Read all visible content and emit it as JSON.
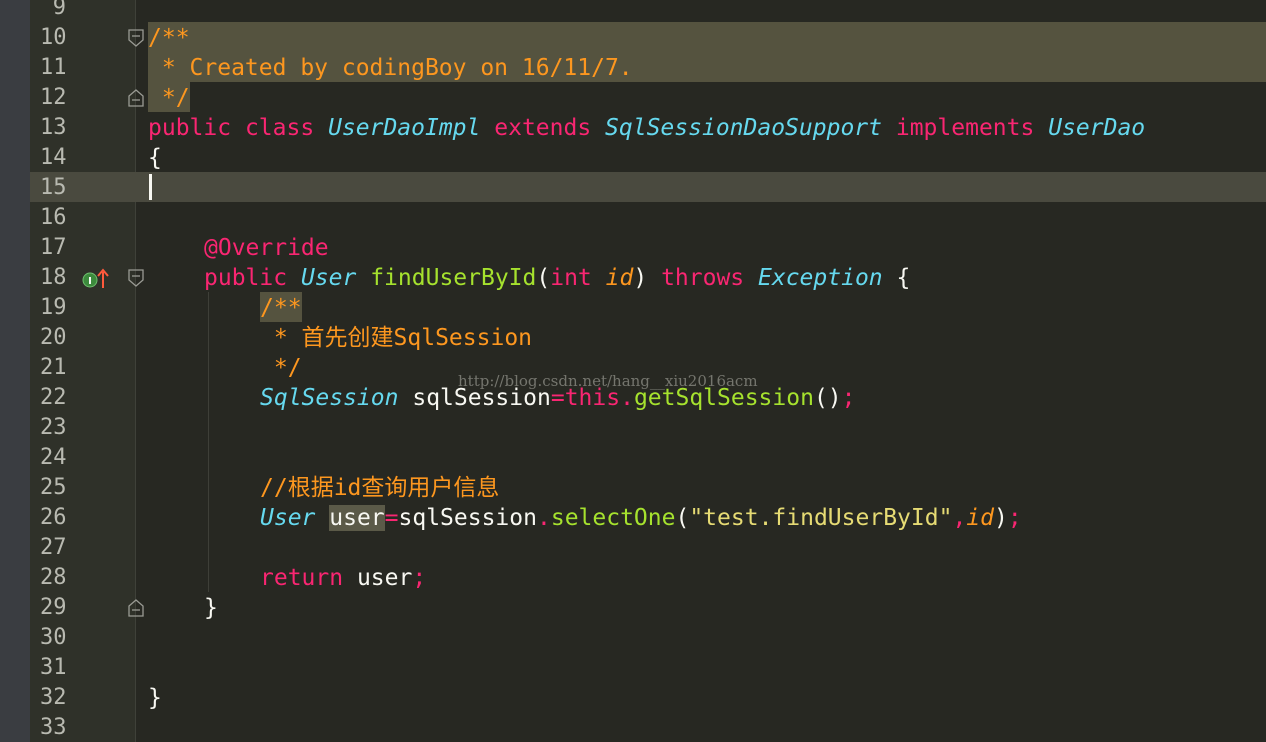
{
  "editor": {
    "line_numbers": [
      "9",
      "10",
      "11",
      "12",
      "13",
      "14",
      "15",
      "16",
      "17",
      "18",
      "19",
      "20",
      "21",
      "22",
      "23",
      "24",
      "25",
      "26",
      "27",
      "28",
      "29",
      "30",
      "31",
      "32",
      "33"
    ],
    "code": {
      "l10": {
        "comment": "/**"
      },
      "l11": {
        "comment": " * Created by codingBoy on 16/11/7."
      },
      "l12": {
        "comment": " */"
      },
      "l13": {
        "kw_public": "public",
        "kw_class": "class",
        "class_name": "UserDaoImpl",
        "kw_extends": "extends",
        "super_class": "SqlSessionDaoSupport",
        "kw_implements": "implements",
        "iface": "UserDao"
      },
      "l14": {
        "brace": "{"
      },
      "l17": {
        "annotation": "@Override"
      },
      "l18": {
        "kw_public": "public",
        "ret_type": "User",
        "method": "findUserById",
        "open": "(",
        "kw_int": "int",
        "param": "id",
        "close": ")",
        "kw_throws": "throws",
        "exc": "Exception",
        "brace": "{"
      },
      "l19": {
        "comment": "/**"
      },
      "l20": {
        "comment": " * 首先创建SqlSession"
      },
      "l21": {
        "comment": " */"
      },
      "l22": {
        "type": "SqlSession",
        "var": "sqlSession",
        "eq": "=",
        "kw_this": "this",
        "dot": ".",
        "call": "getSqlSession",
        "parens": "()",
        "semi": ";"
      },
      "l25": {
        "comment": "//根据id查询用户信息"
      },
      "l26": {
        "type": "User",
        "var": "user",
        "eq": "=",
        "obj": "sqlSession",
        "dot": ".",
        "call": "selectOne",
        "open": "(",
        "str": "\"test.findUserById\"",
        "comma": ",",
        "arg": "id",
        "close": ")",
        "semi": ";"
      },
      "l28": {
        "kw_return": "return",
        "var": "user",
        "semi": ";"
      },
      "l29": {
        "brace": "}"
      },
      "l32": {
        "brace": "}"
      }
    },
    "watermark": "http://blog.csdn.net/hang__xiu2016acm",
    "gutter_icons": {
      "implements_marker": "implements-method-icon",
      "override_arrow": "override-arrow-icon"
    },
    "colors": {
      "background": "#272822",
      "keyword": "#f92672",
      "type": "#66d9ef",
      "function": "#a6e22e",
      "comment": "#fd971f",
      "string": "#e6db74",
      "text": "#f8f8f2"
    }
  }
}
